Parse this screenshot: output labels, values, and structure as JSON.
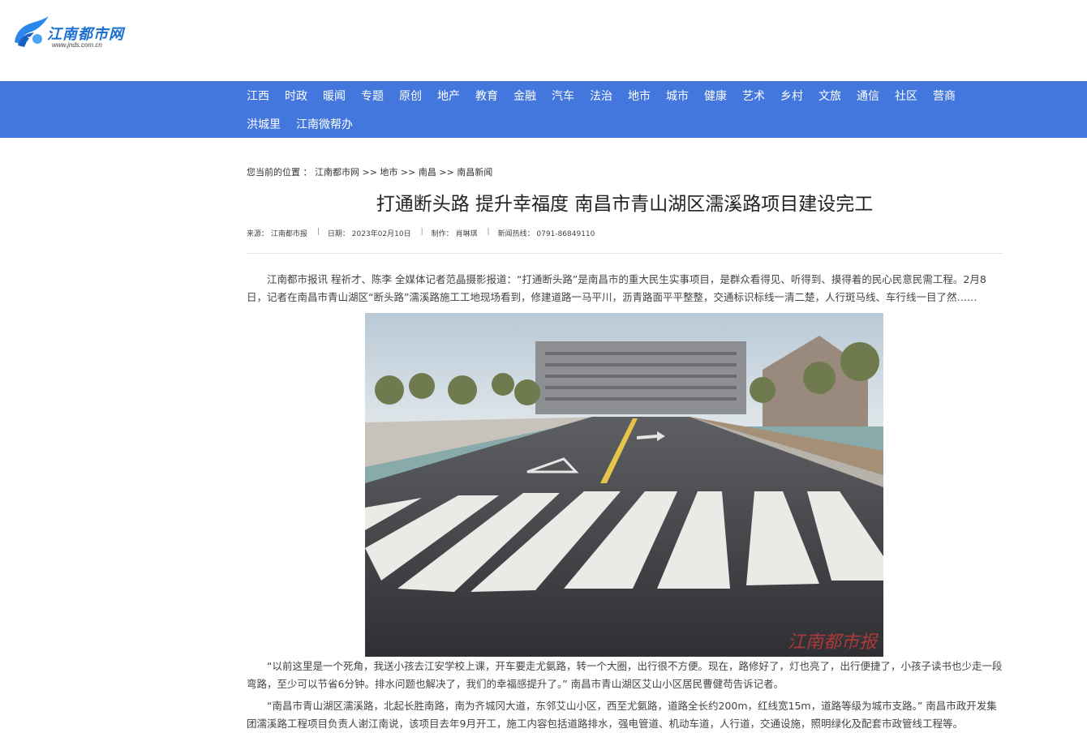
{
  "header": {
    "logo_text": "江南都市网",
    "logo_url": "www.jnds.com.cn"
  },
  "nav": {
    "row1": [
      "江西",
      "时政",
      "暖闻",
      "专题",
      "原创",
      "地产",
      "教育",
      "金融",
      "汽车",
      "法治",
      "地市",
      "城市",
      "健康",
      "艺术",
      "乡村",
      "文旅",
      "通信",
      "社区",
      "营商"
    ],
    "row2": [
      "洪城里",
      "江南微帮办"
    ]
  },
  "breadcrumb": {
    "label": "您当前的位置 ：",
    "path": "江南都市网 >> 地市 >> 南昌 >> 南昌新闻"
  },
  "article": {
    "title": "打通断头路 提升幸福度 南昌市青山湖区濡溪路项目建设完工",
    "meta": {
      "source": "来源：  江南都市报",
      "date": "日期：  2023年02月10日",
      "editor": "制作：  肖琳琪",
      "hotline": "新闻热线：  0791-86849110"
    },
    "p1": "江南都市报讯 程祈才、陈李 全媒体记者范晶摄影报道：“打通断头路”是南昌市的重大民生实事项目，是群众看得见、听得到、摸得着的民心民意民需工程。2月8日，记者在南昌市青山湖区“断头路”濡溪路施工工地现场看到，修建道路一马平川，沥青路面平平整整，交通标识标线一清二楚，人行斑马线、车行线一目了然……",
    "p2": "“以前这里是一个死角，我送小孩去江安学校上课，开车要走尤氨路，转一个大圈，出行很不方便。现在，路修好了，灯也亮了，出行便捷了，小孩子读书也少走一段弯路，至少可以节省6分钟。排水问题也解决了，我们的幸福感提升了。” 南昌市青山湖区艾山小区居民曹健苟告诉记者。",
    "p3": "“南昌市青山湖区濡溪路，北起长胜南路，南为齐城冈大道，东邻艾山小区，西至尤氨路，道路全长约200m，红线宽15m，道路等级为城市支路。” 南昌市政开发集团濡溪路工程项目负责人谢江南说，该项目去年9月开工，施工内容包括道路排水，强电管道、机动车道，人行道，交通设施，照明绿化及配套市政管线工程等。",
    "photo_watermark": "江南都市报"
  },
  "colors": {
    "nav_bg": "#4477dd",
    "logo_blue": "#1a6fd1"
  }
}
